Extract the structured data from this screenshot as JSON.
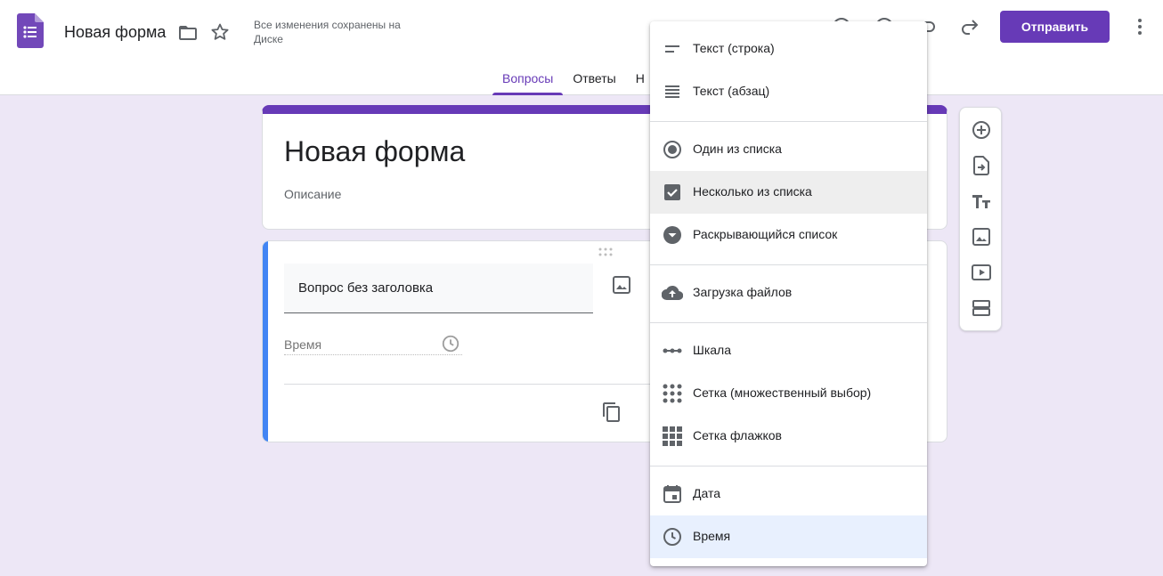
{
  "header": {
    "doc_title": "Новая форма",
    "save_status": "Все изменения сохранены на Диске",
    "send_label": "Отправить",
    "accent": "#673ab7"
  },
  "tabs": [
    {
      "label": "Вопросы",
      "active": true
    },
    {
      "label": "Ответы",
      "active": false
    },
    {
      "label": "Н",
      "active": false
    }
  ],
  "form": {
    "title": "Новая форма",
    "description": "Описание"
  },
  "question": {
    "title": "Вопрос без заголовка",
    "time_placeholder": "Время"
  },
  "menu": {
    "items": [
      {
        "label": "Текст (строка)",
        "icon": "short-text-icon"
      },
      {
        "label": "Текст (абзац)",
        "icon": "paragraph-icon"
      },
      {
        "label": "Один из списка",
        "icon": "radio-icon"
      },
      {
        "label": "Несколько из списка",
        "icon": "checkbox-icon",
        "selected": true
      },
      {
        "label": "Раскрывающийся список",
        "icon": "dropdown-icon"
      },
      {
        "label": "Загрузка файлов",
        "icon": "cloud-upload-icon"
      },
      {
        "label": "Шкала",
        "icon": "linear-scale-icon"
      },
      {
        "label": "Сетка (множественный выбор)",
        "icon": "dots-grid-icon"
      },
      {
        "label": "Сетка флажков",
        "icon": "squares-grid-icon"
      },
      {
        "label": "Дата",
        "icon": "calendar-icon"
      },
      {
        "label": "Время",
        "icon": "clock-icon",
        "highlighted": true
      }
    ]
  },
  "side_panel": {
    "icons": [
      "add-question-icon",
      "import-questions-icon",
      "add-title-icon",
      "add-image-icon",
      "add-video-icon",
      "add-section-icon"
    ]
  }
}
